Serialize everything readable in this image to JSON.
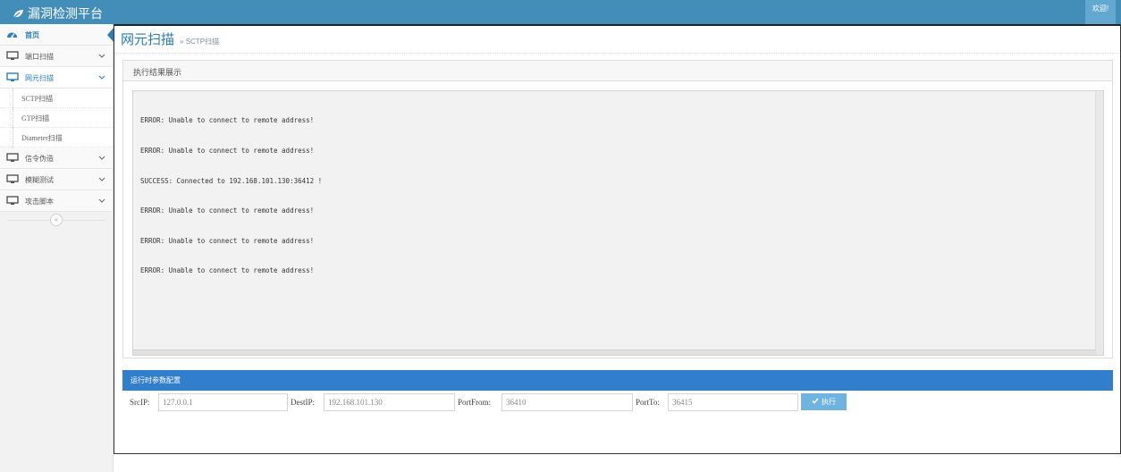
{
  "app": {
    "title": "漏洞检测平台",
    "welcome": "欢迎!"
  },
  "sidebar": {
    "items": [
      {
        "label": "首页",
        "icon": "dashboard-icon"
      },
      {
        "label": "端口扫描",
        "icon": "desktop-icon"
      },
      {
        "label": "网元扫描",
        "icon": "desktop-icon"
      },
      {
        "label": "信令伪造",
        "icon": "desktop-icon"
      },
      {
        "label": "模糊测试",
        "icon": "desktop-icon"
      },
      {
        "label": "攻击脚本",
        "icon": "desktop-icon"
      }
    ],
    "subitems": [
      {
        "label": "SCTP扫描"
      },
      {
        "label": "GTP扫描"
      },
      {
        "label": "Diameter扫描"
      }
    ],
    "collapse_glyph": "«"
  },
  "page": {
    "title": "网元扫描",
    "subtitle": "» SCTP扫描"
  },
  "result": {
    "heading": "执行结果展示",
    "lines": [
      "ERROR: Unable to connect to remote address!",
      "ERROR: Unable to connect to remote address!",
      "SUCCESS: Connected to 192.168.101.130:36412 !",
      "ERROR: Unable to connect to remote address!",
      "ERROR: Unable to connect to remote address!",
      "ERROR: Unable to connect to remote address!"
    ]
  },
  "config": {
    "heading": "运行时参数配置",
    "src_ip_label": "SrcIP:",
    "src_ip_value": "127.0.0.1",
    "dest_ip_label": "DestIP:",
    "dest_ip_value": "192.168.101.130",
    "port_from_label": "PortFrom:",
    "port_from_value": "36410",
    "port_to_label": "PortTo:",
    "port_to_value": "36415",
    "execute_label": "执行"
  },
  "colors": {
    "topbar": "#438eb9",
    "accent": "#2b7dbc",
    "config_header": "#307ecc",
    "button": "#6fb3e0"
  }
}
